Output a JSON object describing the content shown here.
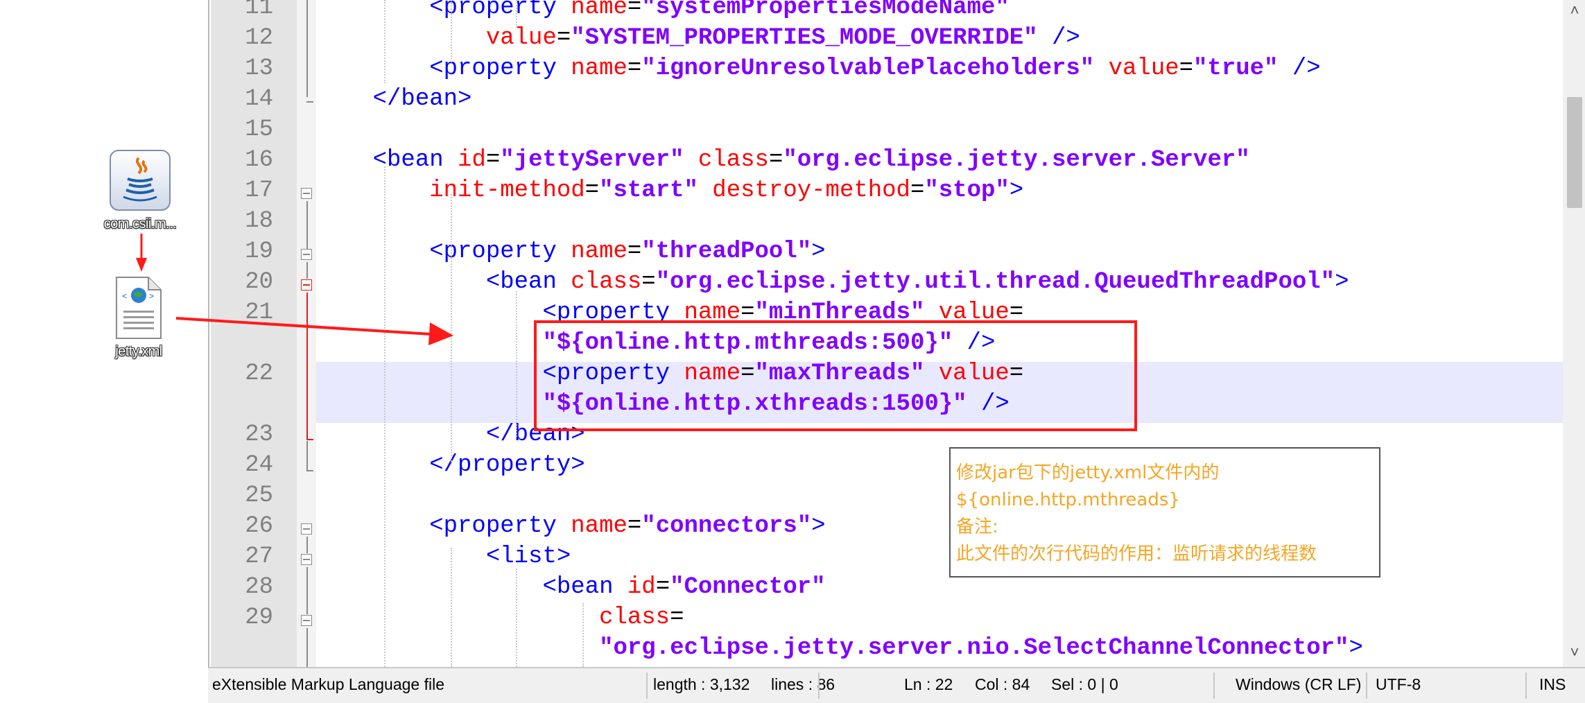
{
  "desktop": {
    "icons": [
      {
        "label": "com.csii.m...",
        "icon": "java-jar-icon"
      },
      {
        "label": "jetty.xml",
        "icon": "xml-file-icon"
      }
    ]
  },
  "editor": {
    "lines": [
      {
        "num": "11",
        "tokens": [
          {
            "c": "t",
            "s": "        <property "
          },
          {
            "c": "a",
            "s": "name"
          },
          {
            "c": "p",
            "s": "="
          },
          {
            "c": "v",
            "s": "\"systemPropertiesModeName\""
          }
        ]
      },
      {
        "num": "12",
        "tokens": [
          {
            "c": "a",
            "s": "            value"
          },
          {
            "c": "p",
            "s": "="
          },
          {
            "c": "v",
            "s": "\"SYSTEM_PROPERTIES_MODE_OVERRIDE\""
          },
          {
            "c": "t",
            "s": " />"
          }
        ]
      },
      {
        "num": "13",
        "tokens": [
          {
            "c": "t",
            "s": "        <property "
          },
          {
            "c": "a",
            "s": "name"
          },
          {
            "c": "p",
            "s": "="
          },
          {
            "c": "v",
            "s": "\"ignoreUnresolvablePlaceholders\""
          },
          {
            "c": "a",
            "s": " value"
          },
          {
            "c": "p",
            "s": "="
          },
          {
            "c": "v",
            "s": "\"true\""
          },
          {
            "c": "t",
            "s": " />"
          }
        ]
      },
      {
        "num": "14",
        "tokens": [
          {
            "c": "t",
            "s": "    </bean>"
          }
        ]
      },
      {
        "num": "15",
        "tokens": []
      },
      {
        "num": "16",
        "tokens": [
          {
            "c": "t",
            "s": "    <bean "
          },
          {
            "c": "a",
            "s": "id"
          },
          {
            "c": "p",
            "s": "="
          },
          {
            "c": "v",
            "s": "\"jettyServer\""
          },
          {
            "c": "a",
            "s": " class"
          },
          {
            "c": "p",
            "s": "="
          },
          {
            "c": "v",
            "s": "\"org.eclipse.jetty.server.Server\""
          }
        ]
      },
      {
        "num": "17",
        "tokens": [
          {
            "c": "a",
            "s": "        init-method"
          },
          {
            "c": "p",
            "s": "="
          },
          {
            "c": "v",
            "s": "\"start\""
          },
          {
            "c": "a",
            "s": " destroy-method"
          },
          {
            "c": "p",
            "s": "="
          },
          {
            "c": "v",
            "s": "\"stop\""
          },
          {
            "c": "t",
            "s": ">"
          }
        ]
      },
      {
        "num": "18",
        "tokens": []
      },
      {
        "num": "19",
        "tokens": [
          {
            "c": "t",
            "s": "        <property "
          },
          {
            "c": "a",
            "s": "name"
          },
          {
            "c": "p",
            "s": "="
          },
          {
            "c": "v",
            "s": "\"threadPool\""
          },
          {
            "c": "t",
            "s": ">"
          }
        ]
      },
      {
        "num": "20",
        "tokens": [
          {
            "c": "t",
            "s": "            <bean "
          },
          {
            "c": "a",
            "s": "class"
          },
          {
            "c": "p",
            "s": "="
          },
          {
            "c": "v",
            "s": "\"org.eclipse.jetty.util.thread.QueuedThreadPool\""
          },
          {
            "c": "t",
            "s": ">"
          }
        ]
      },
      {
        "num": "21",
        "tokens": [
          {
            "c": "t",
            "s": "                <property "
          },
          {
            "c": "a",
            "s": "name"
          },
          {
            "c": "p",
            "s": "="
          },
          {
            "c": "v",
            "s": "\"minThreads\""
          },
          {
            "c": "a",
            "s": " value"
          },
          {
            "c": "p",
            "s": "="
          }
        ]
      },
      {
        "num": "",
        "tokens": [
          {
            "c": "v",
            "s": "                \"${online.http.mthreads:500}\""
          },
          {
            "c": "t",
            "s": " />"
          }
        ]
      },
      {
        "num": "22",
        "tokens": [
          {
            "c": "t",
            "s": "                <property "
          },
          {
            "c": "a",
            "s": "name"
          },
          {
            "c": "p",
            "s": "="
          },
          {
            "c": "v",
            "s": "\"maxThreads\""
          },
          {
            "c": "a",
            "s": " value"
          },
          {
            "c": "p",
            "s": "="
          }
        ]
      },
      {
        "num": "",
        "tokens": [
          {
            "c": "v",
            "s": "                \"${online.http.xthreads:1500}\""
          },
          {
            "c": "t",
            "s": " />"
          }
        ]
      },
      {
        "num": "23",
        "tokens": [
          {
            "c": "t",
            "s": "            </bean>"
          }
        ]
      },
      {
        "num": "24",
        "tokens": [
          {
            "c": "t",
            "s": "        </property>"
          }
        ]
      },
      {
        "num": "25",
        "tokens": []
      },
      {
        "num": "26",
        "tokens": [
          {
            "c": "t",
            "s": "        <property "
          },
          {
            "c": "a",
            "s": "name"
          },
          {
            "c": "p",
            "s": "="
          },
          {
            "c": "v",
            "s": "\"connectors\""
          },
          {
            "c": "t",
            "s": ">"
          }
        ]
      },
      {
        "num": "27",
        "tokens": [
          {
            "c": "t",
            "s": "            <list>"
          }
        ]
      },
      {
        "num": "28",
        "tokens": [
          {
            "c": "t",
            "s": "                <bean "
          },
          {
            "c": "a",
            "s": "id"
          },
          {
            "c": "p",
            "s": "="
          },
          {
            "c": "v",
            "s": "\"Connector\""
          }
        ]
      },
      {
        "num": "29",
        "tokens": [
          {
            "c": "a",
            "s": "                    class"
          },
          {
            "c": "p",
            "s": "="
          }
        ]
      },
      {
        "num": "",
        "tokens": [
          {
            "c": "v",
            "s": "                    \"org.eclipse.jetty.server.nio.SelectChannelConnector\""
          },
          {
            "c": "t",
            "s": ">"
          }
        ]
      }
    ]
  },
  "note": {
    "lines": [
      "修改jar包下的jetty.xml文件内的",
      "${online.http.mthreads}",
      "备注:",
      "此文件的次行代码的作用：监听请求的线程数"
    ]
  },
  "status_bar": {
    "file_type": "eXtensible Markup Language file",
    "length": "length : 3,132",
    "lines": "lines : 86",
    "ln": "Ln : 22",
    "col": "Col : 84",
    "sel": "Sel : 0 | 0",
    "eol": "Windows (CR LF)",
    "encoding": "UTF-8",
    "mode": "INS"
  },
  "colors": {
    "tag": "#0000ff",
    "attribute": "#ff0000",
    "value": "#8000ff",
    "annotation_red": "#ff1a1a",
    "note_text": "#f5a623",
    "current_line": "#e8e8ff"
  }
}
